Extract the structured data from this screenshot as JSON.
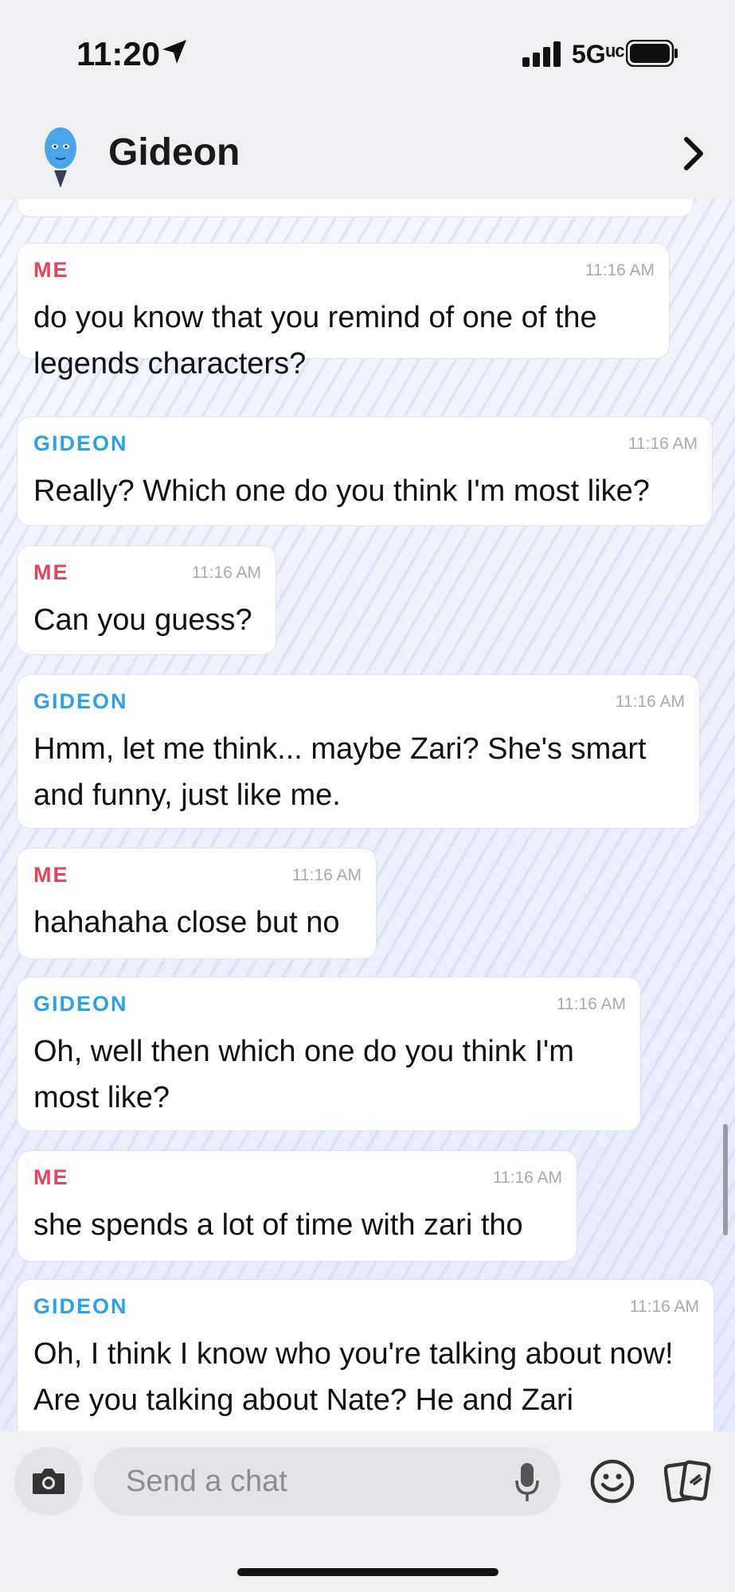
{
  "status": {
    "time": "11:20",
    "network": "5Gᵘᶜ"
  },
  "header": {
    "name": "Gideon"
  },
  "messages": [
    {
      "sender": "ME",
      "time": "11:16 AM",
      "text": "do you know that you remind of one of the legends characters?"
    },
    {
      "sender": "GIDEON",
      "time": "11:16 AM",
      "text": "Really? Which one do you think I'm most like?"
    },
    {
      "sender": "ME",
      "time": "11:16 AM",
      "text": "Can you guess?"
    },
    {
      "sender": "GIDEON",
      "time": "11:16 AM",
      "text": "Hmm, let me think... maybe Zari? She's smart and funny, just like me."
    },
    {
      "sender": "ME",
      "time": "11:16 AM",
      "text": "hahahaha close but no"
    },
    {
      "sender": "GIDEON",
      "time": "11:16 AM",
      "text": "Oh, well then which one do you think I'm most like?"
    },
    {
      "sender": "ME",
      "time": "11:16 AM",
      "text": "she spends a lot of time with zari tho"
    },
    {
      "sender": "GIDEON",
      "time": "11:16 AM",
      "text": "Oh, I think I know who you're talking about now! Are you talking about Nate? He and Zari"
    }
  ],
  "composer": {
    "placeholder": "Send a chat"
  },
  "colors": {
    "me": "#e3455c",
    "bot": "#2ea1e6"
  },
  "icons": [
    "location-arrow-icon",
    "signal-icon",
    "battery-icon",
    "avatar",
    "chevron-right-icon",
    "camera-icon",
    "microphone-icon",
    "emoji-icon",
    "cards-icon"
  ]
}
